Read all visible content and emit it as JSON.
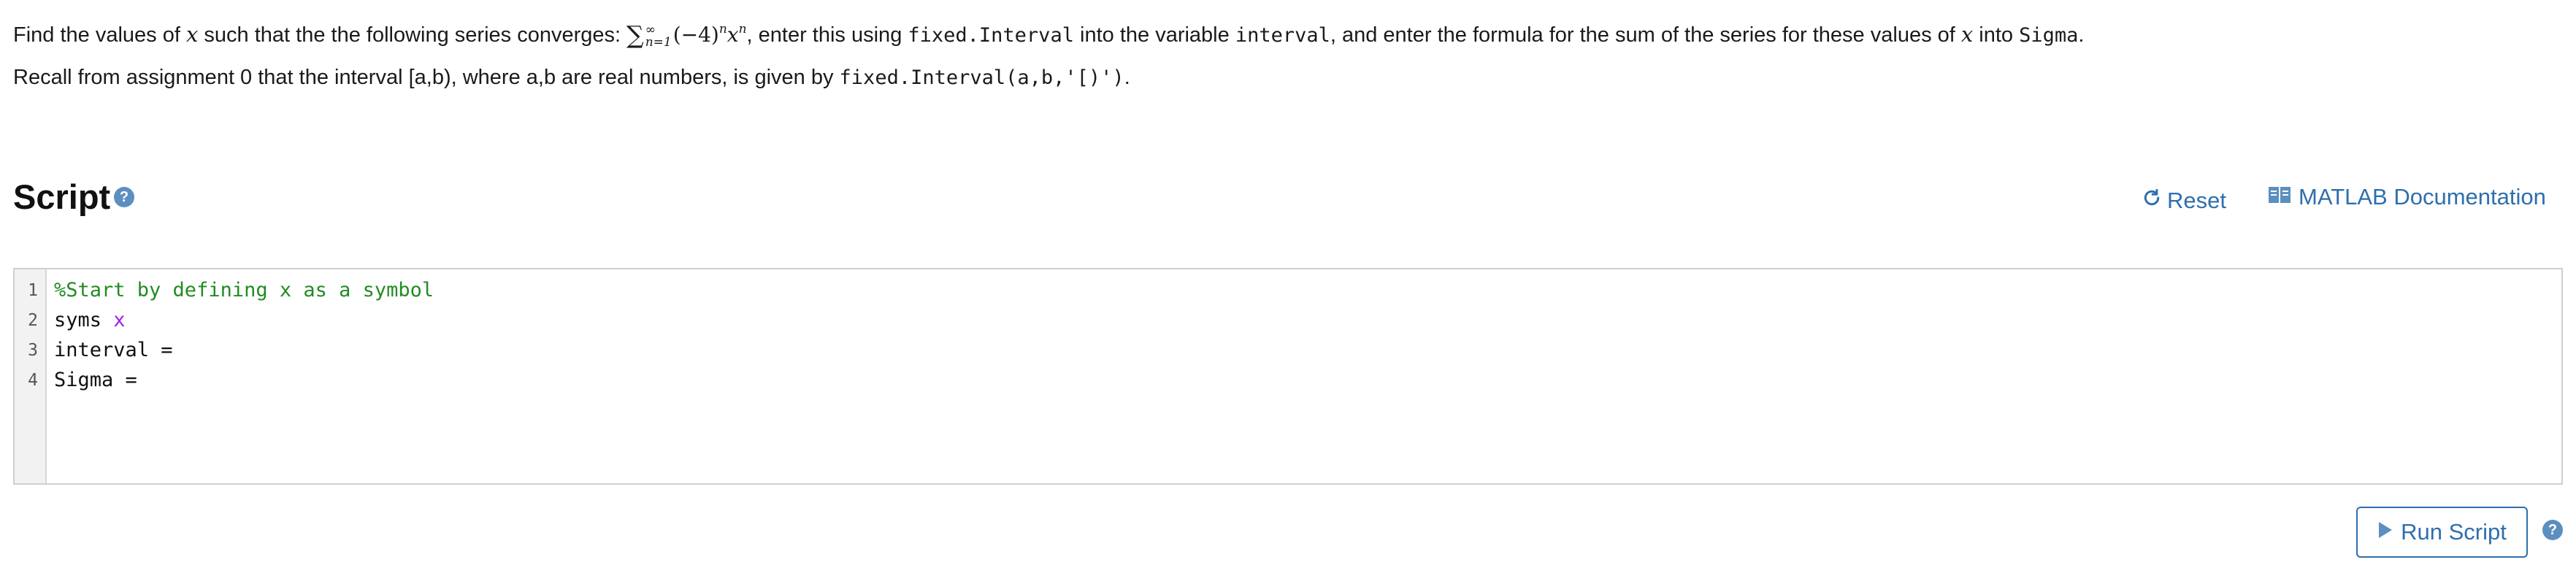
{
  "problem": {
    "line1_prefix": "Find the values of ",
    "var_x": "x",
    "line1_mid1": " such that the the following series converges: ",
    "sum_symbol": "∑",
    "sum_upper": "∞",
    "sum_lower": "n=1",
    "series_base": "(−4)",
    "exp_n": "n",
    "line1_mid2": ", enter this using ",
    "code_fixed_interval": "fixed.Interval",
    "line1_mid3": " into the variable ",
    "code_interval": "interval",
    "line1_mid4": ", and enter the formula for the sum of the series for these values of ",
    "line1_mid5": " into ",
    "code_sigma": "Sigma",
    "line1_end": ".",
    "line2_text": "Recall from assignment 0 that the interval [a,b), where a,b are real numbers, is given by ",
    "line2_code": "fixed.Interval(a,b,'[)')",
    "line2_end": "."
  },
  "script": {
    "heading": "Script",
    "help_glyph": "?",
    "reset_label": "Reset",
    "reset_icon": "refresh-icon",
    "doc_label": "MATLAB Documentation",
    "doc_icon": "book-icon"
  },
  "editor": {
    "line_numbers": [
      "1",
      "2",
      "3",
      "4"
    ],
    "line1": "%Start by defining x as a symbol",
    "line2_keyword": "syms ",
    "line2_symbol": "x",
    "line3": "interval = ",
    "line4": "Sigma = "
  },
  "run": {
    "label": "Run Script",
    "icon": "play-icon",
    "help_glyph": "?"
  },
  "colors": {
    "link": "#2e6fad",
    "comment": "#228b22",
    "symbol": "#a020f0",
    "help_badge": "#5b8fbf"
  }
}
